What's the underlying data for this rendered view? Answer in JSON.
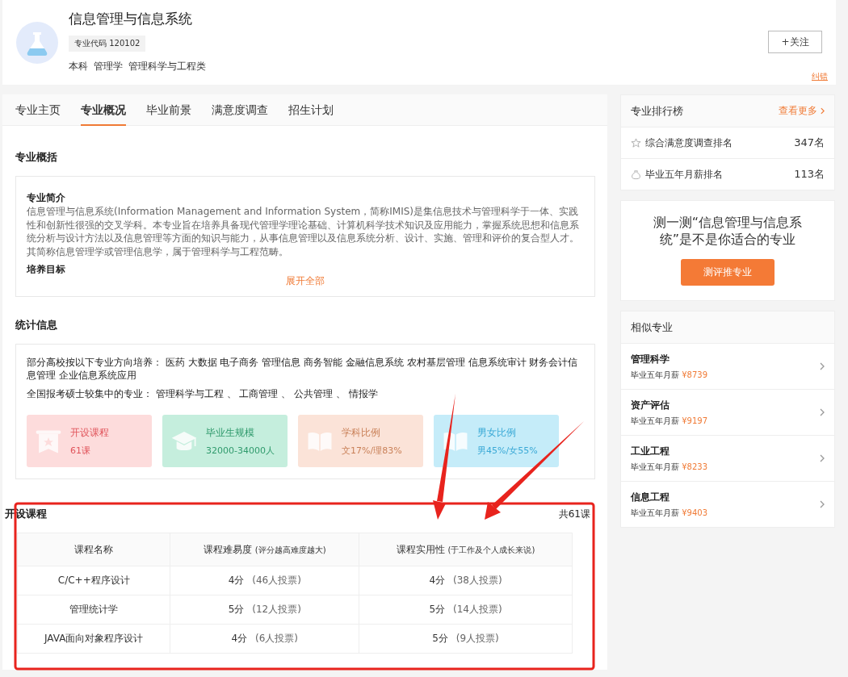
{
  "header": {
    "title": "信息管理与信息系统",
    "code": "专业代码 120102",
    "tags": [
      "本科",
      "管理学",
      "管理科学与工程类"
    ],
    "follow": "+关注",
    "report": "纠错"
  },
  "tabs": [
    {
      "label": "专业主页",
      "selected": false
    },
    {
      "label": "专业概况",
      "selected": true
    },
    {
      "label": "毕业前景",
      "selected": false
    },
    {
      "label": "满意度调查",
      "selected": false
    },
    {
      "label": "招生计划",
      "selected": false
    }
  ],
  "overview": {
    "title": "专业概括",
    "sections": [
      {
        "heading": "专业简介",
        "text": "信息管理与信息系统(Information Management and Information System，简称IMIS)是集信息技术与管理科学于一体、实践性和创新性很强的交叉学科。本专业旨在培养具备现代管理学理论基础、计算机科学技术知识及应用能力，掌握系统思想和信息系统分析与设计方法以及信息管理等方面的知识与能力，从事信息管理以及信息系统分析、设计、实施、管理和评价的复合型人才。其简称信息管理学或管理信息学，属于管理科学与工程范畴。"
      },
      {
        "heading": "培养目标"
      }
    ],
    "expand": "展开全部"
  },
  "stats": {
    "title": "统计信息",
    "lines": [
      "部分高校按以下专业方向培养： 医药 大数据 电子商务 管理信息 商务智能 金融信息系统 农村基层管理 信息系统审计 财务会计信息管理 企业信息系统应用",
      "全国报考硕士较集中的专业： 管理科学与工程 、 工商管理 、 公共管理 、 情报学"
    ],
    "tiles": [
      {
        "kind": "courses",
        "label": "开设课程",
        "value": "61课"
      },
      {
        "kind": "graduates",
        "label": "毕业生规模",
        "value": "32000-34000人"
      },
      {
        "kind": "subjects",
        "label": "学科比例",
        "value": "文17%/理83%"
      },
      {
        "kind": "gender",
        "label": "男女比例",
        "value": "男45%/女55%"
      }
    ]
  },
  "courses": {
    "title": "开设课程",
    "total": "共61课",
    "columns": [
      {
        "label": "课程名称"
      },
      {
        "label": "课程难易度",
        "note": "(评分越高难度越大)"
      },
      {
        "label": "课程实用性",
        "note": "(于工作及个人成长来说)"
      }
    ],
    "rows": [
      {
        "name": "C/C++程序设计",
        "difficulty": {
          "score": "4分",
          "votes": "(46人投票)"
        },
        "usefulness": {
          "score": "4分",
          "votes": "(38人投票)"
        }
      },
      {
        "name": "管理统计学",
        "difficulty": {
          "score": "5分",
          "votes": "(12人投票)"
        },
        "usefulness": {
          "score": "5分",
          "votes": "(14人投票)"
        }
      },
      {
        "name": "JAVA面向对象程序设计",
        "difficulty": {
          "score": "4分",
          "votes": "(6人投票)"
        },
        "usefulness": {
          "score": "5分",
          "votes": "(9人投票)"
        }
      }
    ]
  },
  "ranking": {
    "title": "专业排行榜",
    "more": "查看更多",
    "items": [
      {
        "kind": "star",
        "label": "综合满意度调查排名",
        "value": "347名"
      },
      {
        "kind": "moneybag",
        "label": "毕业五年月薪排名",
        "value": "113名"
      }
    ]
  },
  "quiz": {
    "text": "测一测“信息管理与信息系统”是不是你适合的专业",
    "button": "测评推专业"
  },
  "similar": {
    "title": "相似专业",
    "items": [
      {
        "name": "管理科学",
        "salary_label": "毕业五年月薪",
        "salary": "¥8739"
      },
      {
        "name": "资产评估",
        "salary_label": "毕业五年月薪",
        "salary": "¥9197"
      },
      {
        "name": "工业工程",
        "salary_label": "毕业五年月薪",
        "salary": "¥8233"
      },
      {
        "name": "信息工程",
        "salary_label": "毕业五年月薪",
        "salary": "¥9403"
      }
    ]
  }
}
